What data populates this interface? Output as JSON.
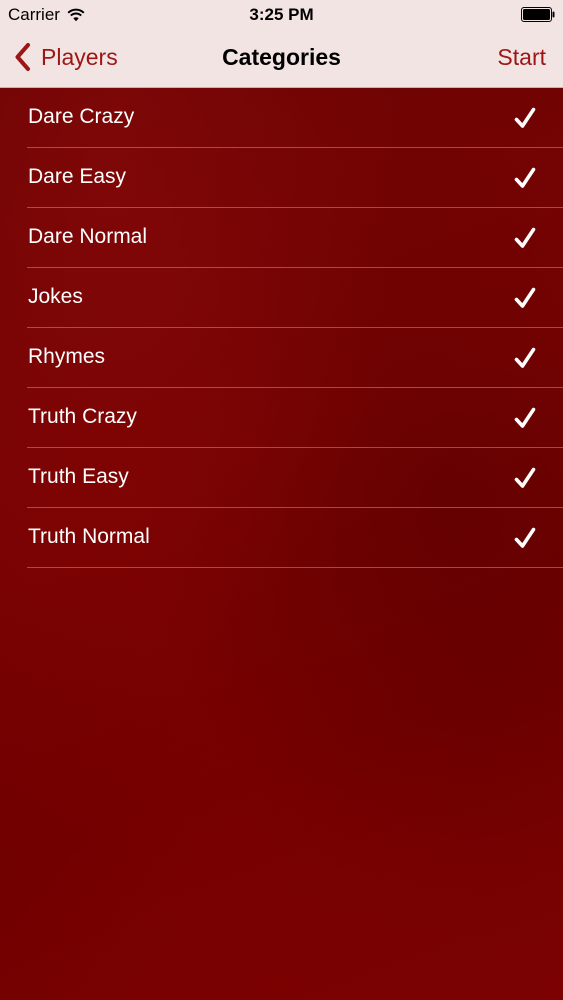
{
  "status_bar": {
    "carrier": "Carrier",
    "time": "3:25 PM",
    "wifi_icon": "wifi-icon",
    "battery_icon": "battery-icon"
  },
  "nav": {
    "back_label": "Players",
    "back_icon": "chevron-left-icon",
    "title": "Categories",
    "action_label": "Start"
  },
  "colors": {
    "accent": "#9c1616",
    "bar_background": "#f2e4e2",
    "content_background": "#7a0000",
    "text_on_content": "#ffffff"
  },
  "categories": [
    {
      "label": "Dare Crazy",
      "checked": true
    },
    {
      "label": "Dare Easy",
      "checked": true
    },
    {
      "label": "Dare Normal",
      "checked": true
    },
    {
      "label": "Jokes",
      "checked": true
    },
    {
      "label": "Rhymes",
      "checked": true
    },
    {
      "label": "Truth Crazy",
      "checked": true
    },
    {
      "label": "Truth Easy",
      "checked": true
    },
    {
      "label": "Truth Normal",
      "checked": true
    }
  ]
}
